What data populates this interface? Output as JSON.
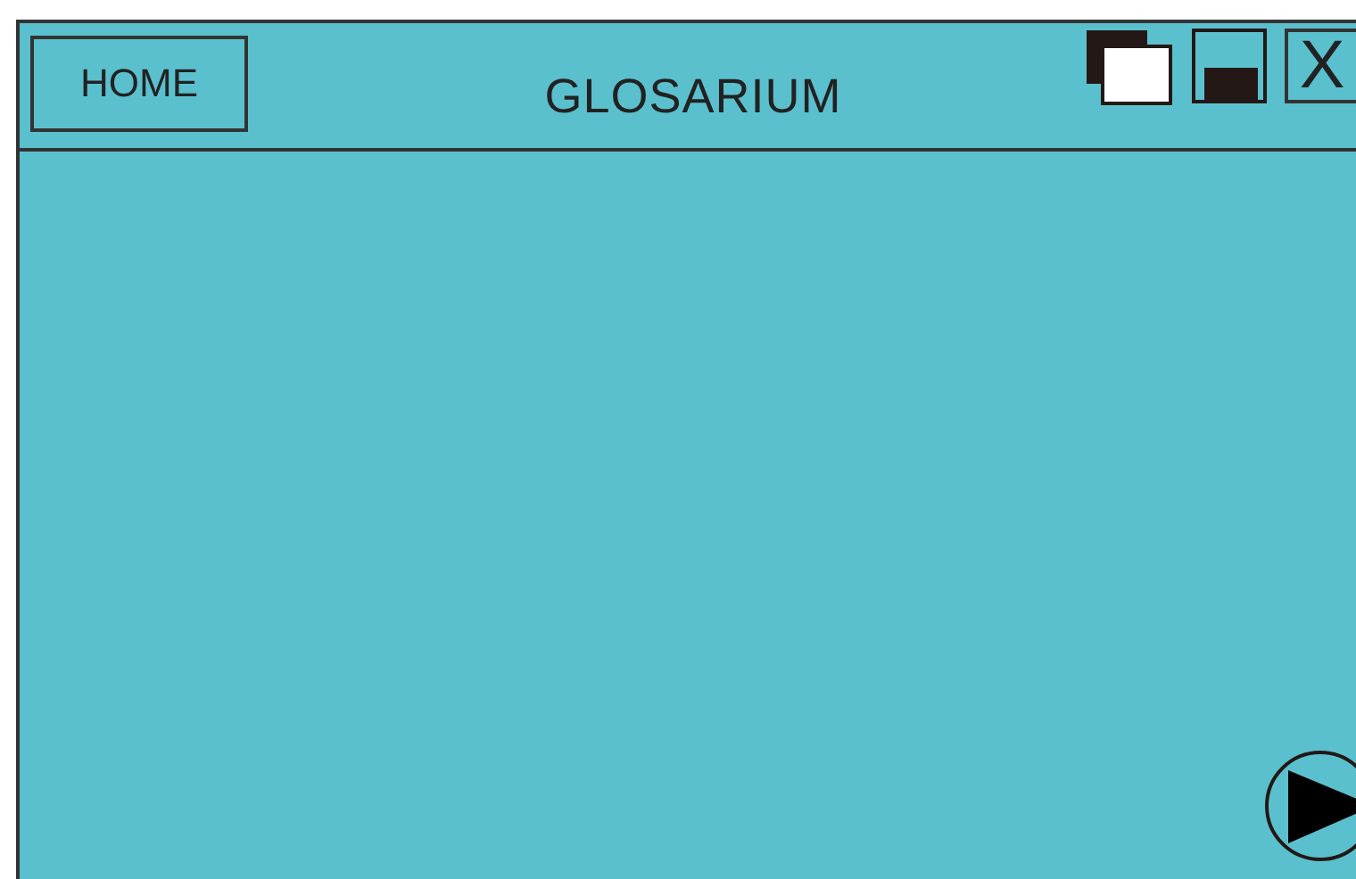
{
  "window": {
    "title": "GLOSARIUM",
    "close_label": "X"
  },
  "home_button": {
    "label": "HOME"
  }
}
